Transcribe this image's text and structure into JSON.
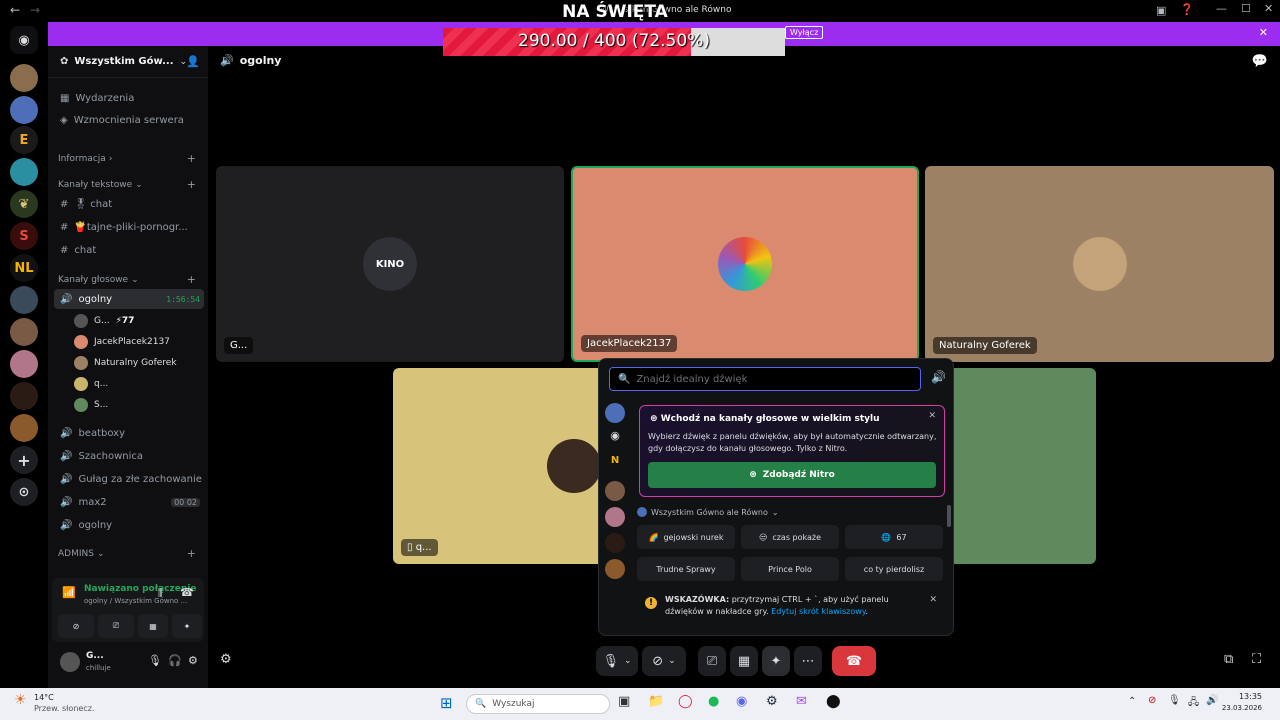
{
  "overlay": {
    "title": "NA ŚWIĘTA",
    "progress_text": "290.00 / 400 (72.50%)",
    "progress_fraction": 0.725
  },
  "window": {
    "title": "Wszystkim Gówno ale Równo"
  },
  "topbar": {
    "button": "Wyłącz",
    "close": "✕"
  },
  "server": {
    "name": "Wszystkim Gów...",
    "chevron": "⌄"
  },
  "header": {
    "channel": "ogolny"
  },
  "menu": {
    "events": "Wydarzenia",
    "boosts": "Wzmocnienia serwera"
  },
  "categories": {
    "info": "Informacja",
    "text": "Kanały tekstowe",
    "voice": "Kanały głosowe",
    "admins": "ADMINS"
  },
  "text_channels": [
    {
      "label": "🎖 chat"
    },
    {
      "label": "🍟tajne-pliki-pornogr..."
    },
    {
      "label": "chat"
    }
  ],
  "voice_active": {
    "label": "ogolny",
    "timer": "1:56:54"
  },
  "voice_users": [
    {
      "name": "G...",
      "extra": "⚡77",
      "color": "#555"
    },
    {
      "name": "JacekPlacek2137",
      "extra": "",
      "color": "#d98a6f"
    },
    {
      "name": "Naturalny Goferek",
      "extra": "",
      "color": "#9d8164"
    },
    {
      "name": "q...",
      "extra": "",
      "color": "#c9b66a"
    },
    {
      "name": "S...",
      "extra": "",
      "color": "#5f8a5e"
    }
  ],
  "voice_channels": [
    {
      "label": "beatboxy",
      "badge": ""
    },
    {
      "label": "Szachownica",
      "badge": ""
    },
    {
      "label": "Gułag za złe zachowanie",
      "badge": ""
    },
    {
      "label": "max2",
      "badge": "00 02"
    },
    {
      "label": "ogolny",
      "badge": ""
    }
  ],
  "connection": {
    "status": "Nawiązano połączenie",
    "detail": "ogolny / Wszystkim Gówno ..."
  },
  "user": {
    "name": "G...",
    "status": "chilluje"
  },
  "tiles": [
    {
      "label": "G...",
      "avatar_text": "KINO"
    },
    {
      "label": "JacekPlacek2137"
    },
    {
      "label": "Naturalny Goferek"
    },
    {
      "label": "q..."
    }
  ],
  "soundboard": {
    "search_placeholder": "Znajdź idealny dźwięk",
    "promo_title": "Wchodź na kanały głosowe w wielkim stylu",
    "promo_text": "Wybierz dźwięk z panelu dźwięków, aby był automatycznie odtwarzany, gdy dołączysz do kanału głosowego. Tylko z Nitro.",
    "promo_button": "Zdobądź Nitro",
    "server_label": "Wszystkim Gówno ale Równo",
    "sounds": [
      {
        "emoji": "🌈",
        "label": "gejowski nurek"
      },
      {
        "emoji": "😒",
        "label": "czas pokaże"
      },
      {
        "emoji": "🌐",
        "label": "67"
      },
      {
        "emoji": "",
        "label": "Trudne Sprawy"
      },
      {
        "emoji": "",
        "label": "Prince Polo"
      },
      {
        "emoji": "",
        "label": "co ty pierdolisz"
      }
    ],
    "tip_bold": "WSKAZÓWKA:",
    "tip_text": "przytrzymaj CTRL + `, aby użyć panelu dźwięków w nakładce gry.",
    "tip_link": "Edytuj skrót klawiszowy",
    "tip_end": "."
  },
  "taskbar": {
    "weather_temp": "14°C",
    "weather_desc": "Przew. słonecz.",
    "search": "Wyszukaj",
    "time": "13:35",
    "date": "23.03.2026"
  }
}
